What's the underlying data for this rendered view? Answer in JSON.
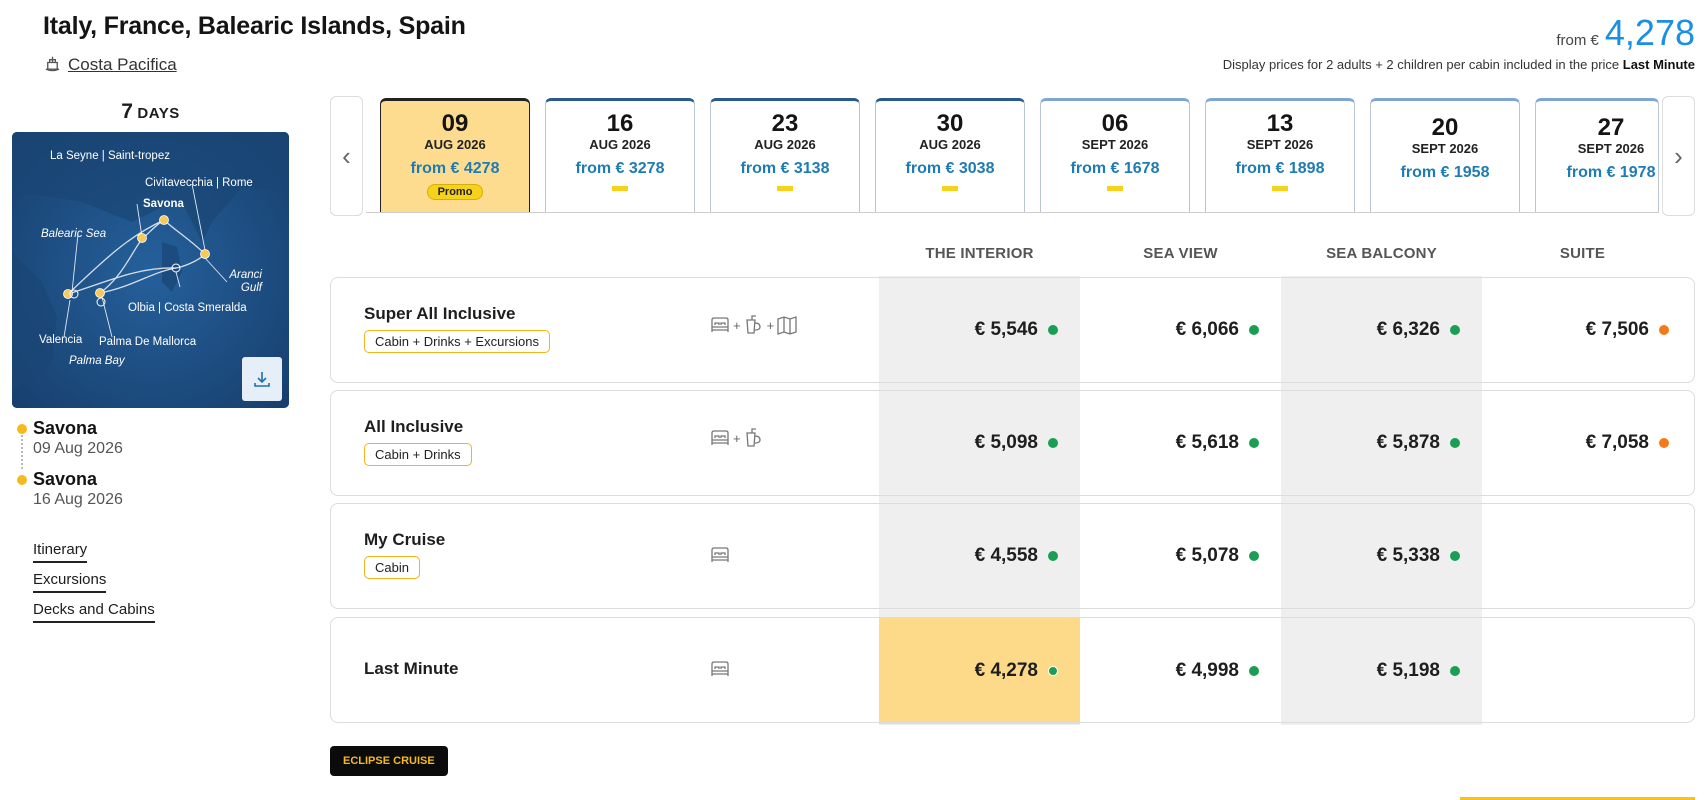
{
  "header": {
    "title": "Italy, France, Balearic Islands, Spain",
    "ship": "Costa Pacifica",
    "price_from_label": "from €",
    "price_from_amount": "4,278",
    "display_note": "Display prices for 2 adults + 2 children per cabin included in the price",
    "display_note_bold": "Last Minute"
  },
  "sidebar": {
    "days_number": "7",
    "days_unit": "DAYS",
    "map_labels": {
      "la_seyne": "La Seyne | Saint-tropez",
      "civitavecchia": "Civitavecchia | Rome",
      "savona": "Savona",
      "balearic_sea": "Balearic Sea",
      "aranci_gulf": "Aranci Gulf",
      "olbia": "Olbia | Costa Smeralda",
      "valencia": "Valencia",
      "palma_de_mallorca": "Palma De Mallorca",
      "palma_bay": "Palma Bay"
    },
    "stops": [
      {
        "name": "Savona",
        "date": "09 Aug 2026"
      },
      {
        "name": "Savona",
        "date": "16 Aug 2026"
      }
    ],
    "links": [
      "Itinerary",
      "Excursions",
      "Decks and Cabins"
    ]
  },
  "dates": [
    {
      "day": "09",
      "month": "AUG 2026",
      "price": "from € 4278",
      "promo": "Promo"
    },
    {
      "day": "16",
      "month": "AUG 2026",
      "price": "from € 3278"
    },
    {
      "day": "23",
      "month": "AUG 2026",
      "price": "from € 3138"
    },
    {
      "day": "30",
      "month": "AUG 2026",
      "price": "from € 3038"
    },
    {
      "day": "06",
      "month": "SEPT 2026",
      "price": "from € 1678"
    },
    {
      "day": "13",
      "month": "SEPT 2026",
      "price": "from € 1898"
    },
    {
      "day": "20",
      "month": "SEPT 2026",
      "price": "from € 1958"
    },
    {
      "day": "27",
      "month": "SEPT 2026",
      "price": "from € 1978"
    }
  ],
  "table": {
    "columns": [
      "THE INTERIOR",
      "SEA VIEW",
      "SEA BALCONY",
      "SUITE"
    ],
    "rows": [
      {
        "name": "Super All Inclusive",
        "badge": "Cabin + Drinks + Excursions",
        "icons": [
          "bed-icon",
          "drink-icon",
          "map-icon"
        ],
        "prices": [
          "€ 5,546",
          "€ 6,066",
          "€ 6,326",
          "€ 7,506"
        ],
        "status": [
          "green",
          "green",
          "green",
          "orange"
        ]
      },
      {
        "name": "All Inclusive",
        "badge": "Cabin + Drinks",
        "icons": [
          "bed-icon",
          "drink-icon"
        ],
        "prices": [
          "€ 5,098",
          "€ 5,618",
          "€ 5,878",
          "€ 7,058"
        ],
        "status": [
          "green",
          "green",
          "green",
          "orange"
        ]
      },
      {
        "name": "My Cruise",
        "badge": "Cabin",
        "icons": [
          "bed-icon"
        ],
        "prices": [
          "€ 4,558",
          "€ 5,078",
          "€ 5,338",
          ""
        ],
        "status": [
          "green",
          "green",
          "green",
          ""
        ]
      },
      {
        "name": "Last Minute",
        "badge": "",
        "icons": [
          "bed-icon"
        ],
        "prices": [
          "€ 4,278",
          "€ 4,998",
          "€ 5,198",
          ""
        ],
        "status": [
          "green",
          "green",
          "green",
          ""
        ]
      }
    ]
  },
  "footer": {
    "eclipse_label": "ECLIPSE CRUISE"
  },
  "colors": {
    "accent_blue": "#1a8fe3",
    "promo_yellow": "#f7d21a",
    "highlight": "#fcda8a",
    "status_green": "#1a9e53",
    "status_orange": "#f37a1a"
  }
}
